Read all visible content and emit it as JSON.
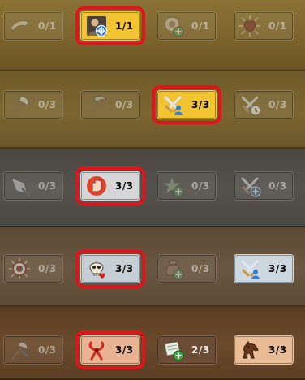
{
  "rows": [
    {
      "cells": [
        {
          "icon": "horn-icon",
          "count": "0/1",
          "state": "dim"
        },
        {
          "icon": "archer-portrait-icon",
          "count": "1/1",
          "state": "complete",
          "highlighted": true,
          "bg": "#f3c431"
        },
        {
          "icon": "shield-plus-icon",
          "count": "0/1",
          "state": "dim"
        },
        {
          "icon": "heart-burst-icon",
          "count": "0/1",
          "state": "dim"
        }
      ]
    },
    {
      "cells": [
        {
          "icon": "axe-icon",
          "count": "0/3",
          "state": "dim"
        },
        {
          "icon": "pickaxe-icon",
          "count": "0/3",
          "state": "dim"
        },
        {
          "icon": "crossed-swords-user-icon",
          "count": "3/3",
          "state": "complete",
          "highlighted": true,
          "bg": "#f3c431"
        },
        {
          "icon": "crossed-swords-clock-icon",
          "count": "0/3",
          "state": "dim"
        }
      ]
    },
    {
      "cells": [
        {
          "icon": "spear-icon",
          "count": "0/3",
          "state": "dim"
        },
        {
          "icon": "raised-fist-icon",
          "count": "3/3",
          "state": "complete",
          "highlighted": true,
          "bg": "#d6d6d8"
        },
        {
          "icon": "star-plus-icon",
          "count": "0/3",
          "state": "dim"
        },
        {
          "icon": "crossed-swords-plus-icon",
          "count": "0/3",
          "state": "dim"
        }
      ]
    },
    {
      "cells": [
        {
          "icon": "target-burst-icon",
          "count": "0/3",
          "state": "dim"
        },
        {
          "icon": "skull-heart-icon",
          "count": "3/3",
          "state": "complete",
          "highlighted": true,
          "bg": "#c6ced6"
        },
        {
          "icon": "sack-plus-icon",
          "count": "0/3",
          "state": "dim"
        },
        {
          "icon": "crossed-swords-user-icon",
          "count": "3/3",
          "state": "complete",
          "highlighted": false,
          "bg": "#cdd7e0"
        }
      ]
    },
    {
      "cells": [
        {
          "icon": "horn-axe-icon",
          "count": "0/3",
          "state": "dim"
        },
        {
          "icon": "ribbon-knot-icon",
          "count": "3/3",
          "state": "complete",
          "highlighted": true,
          "bg": "#e8b392"
        },
        {
          "icon": "scroll-plus-icon",
          "count": "2/3",
          "state": "partial",
          "bg": "#6b4c35"
        },
        {
          "icon": "horse-icon",
          "count": "3/3",
          "state": "complete",
          "highlighted": false,
          "bg": "#e9bc95"
        }
      ]
    }
  ]
}
